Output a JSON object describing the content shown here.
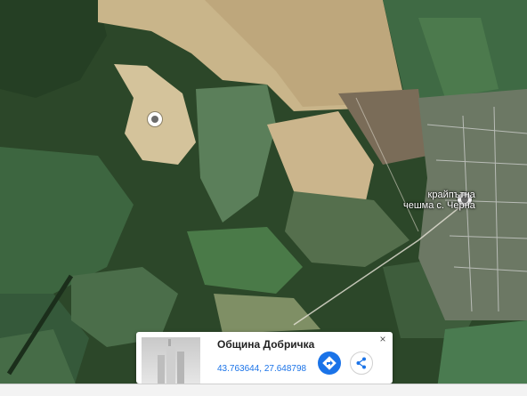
{
  "map": {
    "place_label_line1": "крайпътна",
    "place_label_line2": "чешма с. Черна"
  },
  "info_card": {
    "title": "Община Добричка",
    "coordinates": "43.763644, 27.648798",
    "close_symbol": "×",
    "directions_icon": "directions-icon",
    "share_icon": "share-icon"
  },
  "colors": {
    "accent": "#1a73e8"
  }
}
